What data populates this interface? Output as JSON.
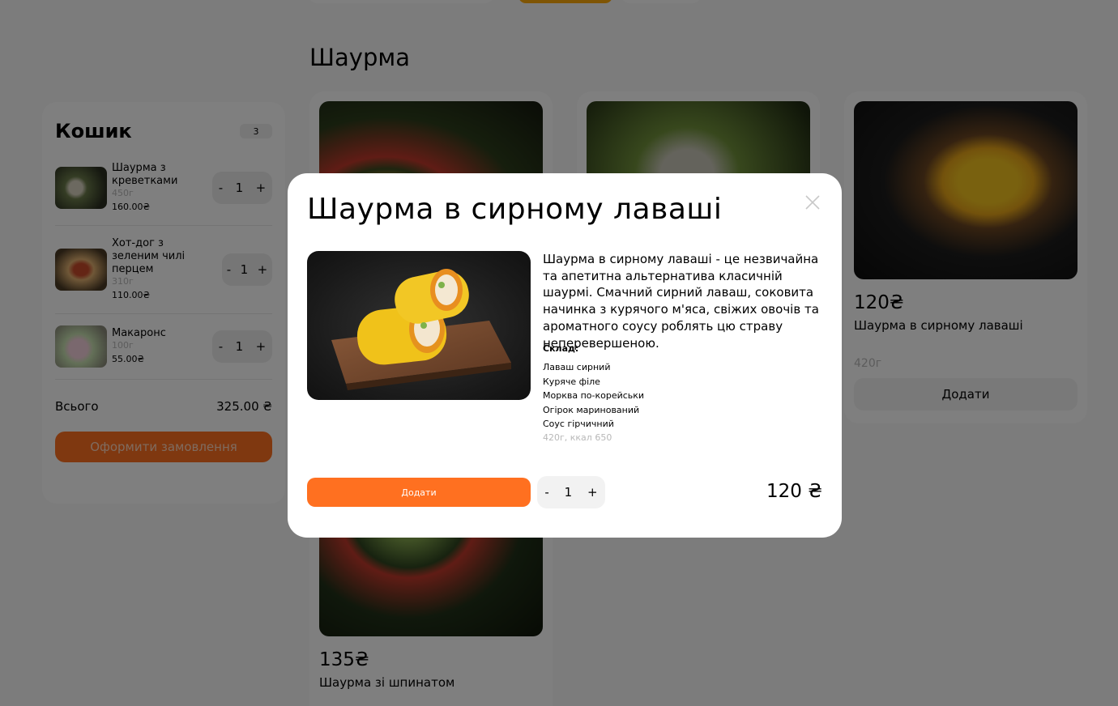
{
  "section_title": "Шаурма",
  "cart": {
    "title": "Кошик",
    "count": "3",
    "items": [
      {
        "name": "Шаурма з креветками",
        "weight": "450г",
        "price": "160.00₴",
        "qty": "1"
      },
      {
        "name": "Хот-дог з зеленим чилі перцем",
        "weight": "310г",
        "price": "110.00₴",
        "qty": "1"
      },
      {
        "name": "Макаронс",
        "weight": "100г",
        "price": "55.00₴",
        "qty": "1"
      }
    ],
    "total_label": "Всього",
    "total_value": "325.00 ₴",
    "checkout_label": "Оформити замовлення",
    "minus": "-",
    "plus": "+"
  },
  "products": [
    {
      "price": "120₴",
      "name": "Шаурма в сирному лаваші",
      "weight": "420г",
      "add_label": "Додати"
    },
    {
      "price": "135₴",
      "name": "Шаурма зі шпинатом"
    }
  ],
  "modal": {
    "title": "Шаурма в сирному лаваші",
    "description": "Шаурма в сирному лаваші - це незвичайна та апетитна альтернатива класичній шаурмі. Смачний сирний лаваш, соковита начинка з курячого м'яса, свіжих овочів та ароматного соусу роблять цю страву неперевершеною.",
    "ingredients_label": "Склад:",
    "ingredients": [
      "Лаваш сирний",
      "Куряче філе",
      "Морква по-корейськи",
      "Огірок маринований",
      "Соус гірчичний"
    ],
    "meta": "420г, ккал 650",
    "add_label": "Додати",
    "qty": "1",
    "minus": "-",
    "plus": "+",
    "price": "120 ₴"
  },
  "colors": {
    "accent": "#ff7020",
    "brand_yellow": "#ffab08",
    "overlay": "rgba(0,0,0,0.5)"
  },
  "icons": {
    "close": "close-icon"
  }
}
